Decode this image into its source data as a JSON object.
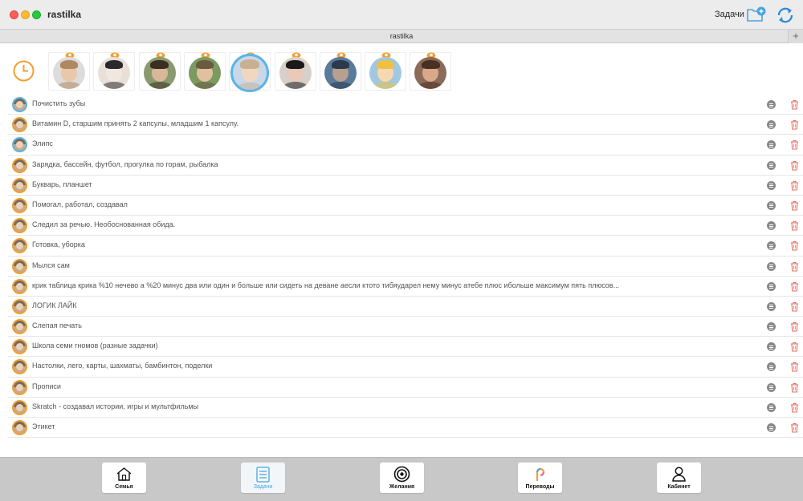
{
  "window": {
    "title": "rastilka",
    "tasks_label": "Задачи"
  },
  "tab": {
    "label": "rastilka",
    "add_symbol": "+"
  },
  "avatars": [
    {
      "name": "avatar-1",
      "hair": "#b08860",
      "skin": "#e8c8a8",
      "bg": "#dcdcdc",
      "selected": false
    },
    {
      "name": "avatar-2",
      "hair": "#2a2a2a",
      "skin": "#f0e8e0",
      "bg": "#e8e0d8",
      "selected": false
    },
    {
      "name": "avatar-3",
      "hair": "#3a3020",
      "skin": "#d8b898",
      "bg": "#8a9a70",
      "selected": false
    },
    {
      "name": "avatar-4",
      "hair": "#6a5a40",
      "skin": "#e0c0a0",
      "bg": "#7a9a60",
      "selected": false
    },
    {
      "name": "avatar-5",
      "hair": "#c8b090",
      "skin": "#f0d8c0",
      "bg": "#c8d8e8",
      "selected": true
    },
    {
      "name": "avatar-6",
      "hair": "#1a1a1a",
      "skin": "#e8c8b8",
      "bg": "#d8d0c8",
      "selected": false
    },
    {
      "name": "avatar-7",
      "hair": "#2a3a4a",
      "skin": "#b8a090",
      "bg": "#5a7a9a",
      "selected": false
    },
    {
      "name": "avatar-8",
      "hair": "#f0c040",
      "skin": "#f8d8b0",
      "bg": "#a0c8e0",
      "selected": false
    },
    {
      "name": "avatar-9",
      "hair": "#4a3020",
      "skin": "#d8a888",
      "bg": "#8a6a58",
      "selected": false
    }
  ],
  "tasks": [
    {
      "text": "Почистить зубы",
      "avatar": "blue"
    },
    {
      "text": "Витамин D, старшим принять 2 капсулы, младшим 1 капсулу.",
      "avatar": "orange"
    },
    {
      "text": "Элипс",
      "avatar": "blue"
    },
    {
      "text": "Зарядка, бассейн, футбол, прогулка по горам, рыбалка",
      "avatar": "orange"
    },
    {
      "text": "Букварь, планшет",
      "avatar": "orange"
    },
    {
      "text": "Помогал, работал, создавал",
      "avatar": "orange"
    },
    {
      "text": "Следил за речью. Необоснованная обида.",
      "avatar": "orange"
    },
    {
      "text": "Готовка, уборка",
      "avatar": "orange"
    },
    {
      "text": "Мылся сам",
      "avatar": "orange"
    },
    {
      "text": "крик таблица крика %10 нечево а %20 минус два или один и больше или сидеть на деване аесли ктото тибяударел нему минус атебе плюс ибольше максимум пять плюсов...",
      "avatar": "orange"
    },
    {
      "text": "ЛОГИК ЛАЙК",
      "avatar": "orange"
    },
    {
      "text": "Слепая печать",
      "avatar": "orange"
    },
    {
      "text": "Школа семи гномов (разные задачки)",
      "avatar": "orange"
    },
    {
      "text": "Настолки, лего, карты, шахматы, бамбинтон, поделки",
      "avatar": "orange"
    },
    {
      "text": "Прописи",
      "avatar": "orange"
    },
    {
      "text": "Skratch - создавал истории, игры и мультфильмы",
      "avatar": "orange"
    },
    {
      "text": "Этикет",
      "avatar": "orange"
    }
  ],
  "bottom_tabs": [
    {
      "label": "Семья",
      "icon": "house-icon",
      "active": false
    },
    {
      "label": "Задачи",
      "icon": "checklist-icon",
      "active": true
    },
    {
      "label": "Желания",
      "icon": "target-icon",
      "active": false
    },
    {
      "label": "Переводы",
      "icon": "transfer-icon",
      "active": false
    },
    {
      "label": "Кабинет",
      "icon": "person-icon",
      "active": false
    }
  ],
  "colors": {
    "accent": "#4aa3e0",
    "avatar_border_orange": "#f0a030",
    "avatar_border_blue": "#5ab4e6",
    "trash": "#e86a5a",
    "clock": "#f0a030"
  }
}
